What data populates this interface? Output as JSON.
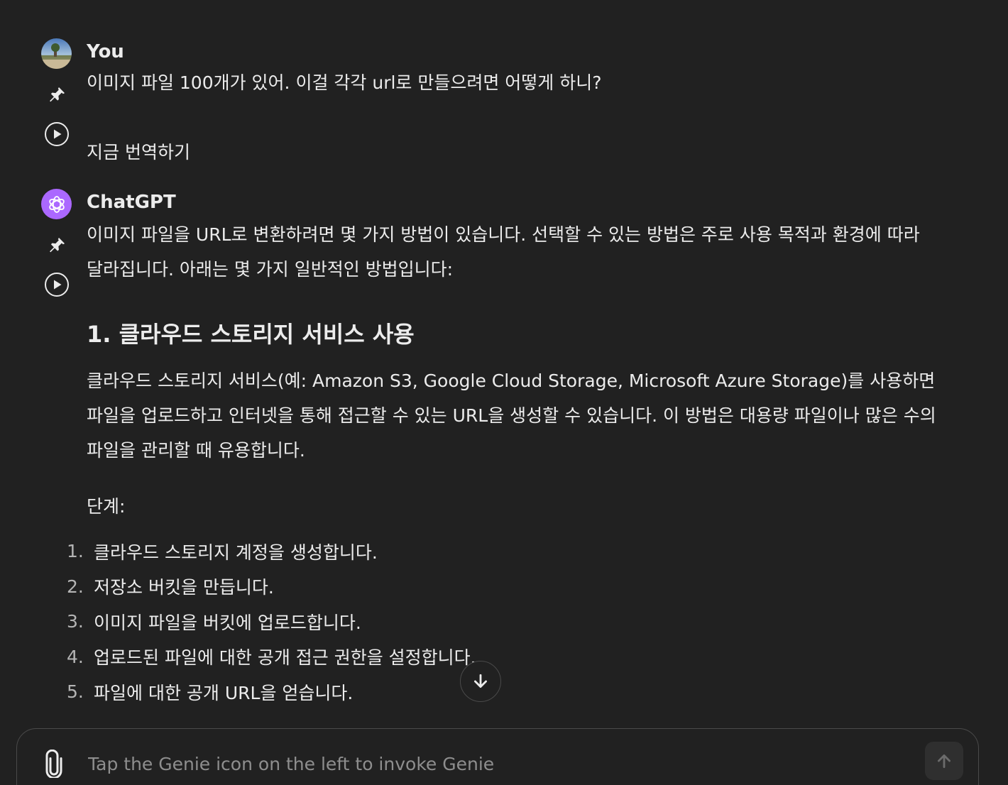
{
  "conversation": {
    "user": {
      "author": "You",
      "message": "이미지 파일 100개가 있어. 이걸 각각 url로 만들으려면 어떻게 하니?",
      "translate_label": "지금 번역하기"
    },
    "assistant": {
      "author": "ChatGPT",
      "intro_line1": "이미지 파일을 URL로 변환하려면 몇 가지 방법이 있습니다. 선택할 수 있는 방법은 주로 사용 목적과 환경에 따라",
      "intro_line2": "달라집니다. 아래는 몇 가지 일반적인 방법입니다:",
      "section_heading": "1. 클라우드 스토리지 서비스 사용",
      "section_paragraph": "클라우드 스토리지 서비스(예: Amazon S3, Google Cloud Storage, Microsoft Azure Storage)를 사용하면 파일을 업로드하고 인터넷을 통해 접근할 수 있는 URL을 생성할 수 있습니다. 이 방법은 대용량 파일이나 많은 수의 파일을 관리할 때 유용합니다.",
      "steps_label": "단계:",
      "steps": [
        {
          "num": "1.",
          "text": "클라우드 스토리지 계정을 생성합니다."
        },
        {
          "num": "2.",
          "text": "저장소 버킷을 만듭니다."
        },
        {
          "num": "3.",
          "text": "이미지 파일을 버킷에 업로드합니다."
        },
        {
          "num": "4.",
          "text": "업로드된 파일에 대한 공개 접근 권한을 설정합니다."
        },
        {
          "num": "5.",
          "text": "파일에 대한 공개 URL을 얻습니다."
        }
      ]
    }
  },
  "composer": {
    "placeholder": "Tap the Genie icon on the left to invoke Genie"
  },
  "icons": {
    "pin": "pin-icon",
    "play": "play-icon",
    "scroll_down": "arrow-down-icon",
    "attach": "paperclip-icon",
    "send": "arrow-up-icon"
  },
  "colors": {
    "background": "#212121",
    "text": "#ececec",
    "muted": "#8e8e8e",
    "chatgpt_avatar": "#ab68ff"
  }
}
